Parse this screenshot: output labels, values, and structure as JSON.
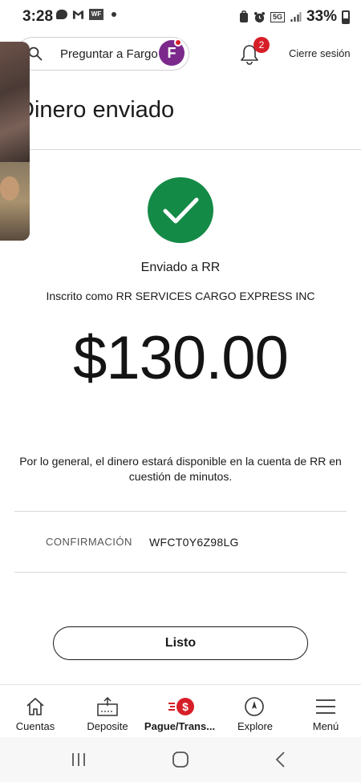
{
  "status_bar": {
    "time": "3:28",
    "battery": "33%",
    "network": "5G"
  },
  "header": {
    "ask_placeholder": "Preguntar a Fargo",
    "notification_count": "2",
    "logout_label": "Cierre sesión"
  },
  "page": {
    "title": "Dinero enviado"
  },
  "confirmation": {
    "sent_to": "Enviado a RR",
    "enrolled_as": "Inscrito como RR SERVICES CARGO EXPRESS INC",
    "amount": "$130.00",
    "availability_note": "Por lo general, el dinero estará disponible en la cuenta de RR en cuestión de minutos.",
    "confirmation_label": "CONFIRMACIÓN",
    "confirmation_code": "WFCT0Y6Z98LG",
    "done_button": "Listo"
  },
  "bottom_nav": [
    {
      "label": "Cuentas",
      "icon": "home-icon"
    },
    {
      "label": "Deposite",
      "icon": "deposit-icon"
    },
    {
      "label": "Pague/Trans...",
      "icon": "pay-transfer-icon",
      "active": true
    },
    {
      "label": "Explore",
      "icon": "compass-icon"
    },
    {
      "label": "Menú",
      "icon": "menu-icon"
    }
  ],
  "colors": {
    "success_green": "#148a47",
    "brand_red": "#d71e28",
    "fargo_purple": "#7b2a8c"
  }
}
